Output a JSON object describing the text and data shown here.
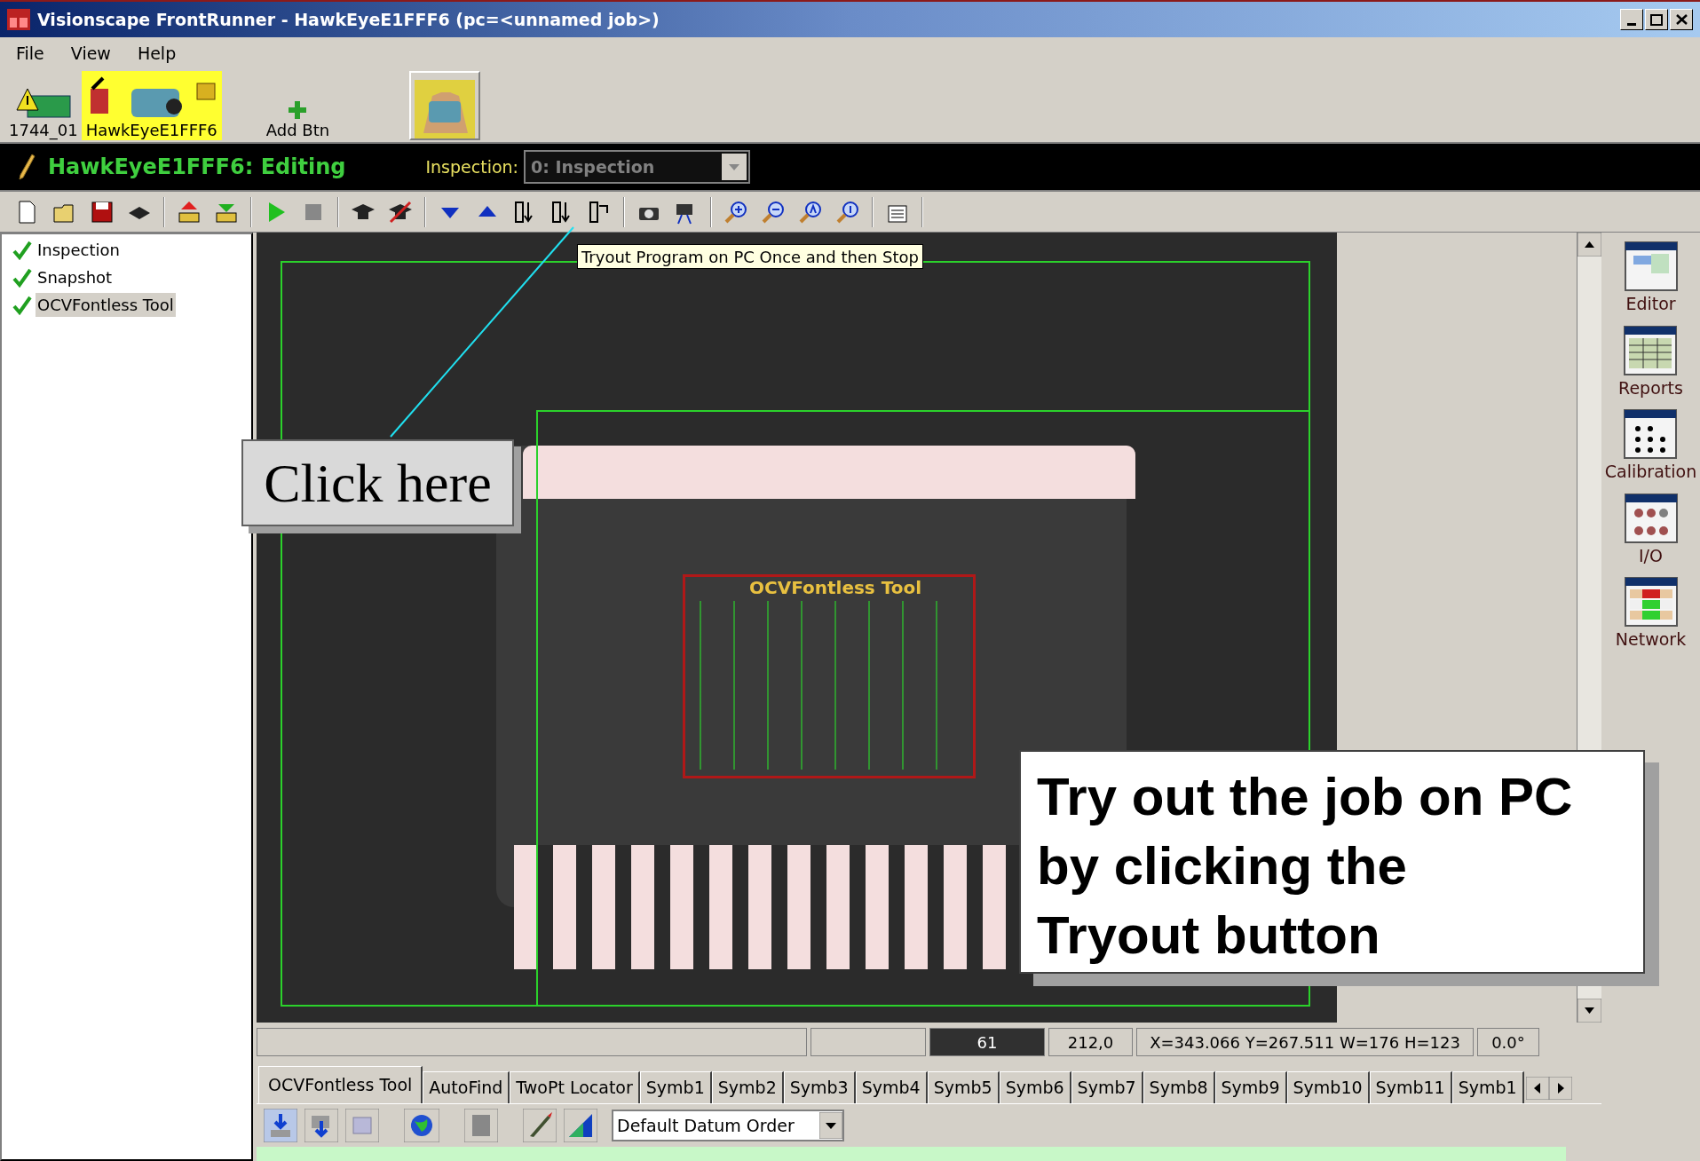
{
  "window": {
    "title": "Visionscape FrontRunner - HawkEyeE1FFF6 (pc=<unnamed job>)"
  },
  "menu": [
    "File",
    "View",
    "Help"
  ],
  "devices": [
    {
      "kind": "board",
      "label": "1744_01",
      "selected": false
    },
    {
      "kind": "camera",
      "label": "HawkEyeE1FFF6",
      "selected": true
    },
    {
      "kind": "add",
      "label": "Add Btn",
      "selected": false
    },
    {
      "kind": "hand",
      "selected": false
    }
  ],
  "editing_bar": {
    "title": "HawkEyeE1FFF6: Editing",
    "inspection_label": "Inspection:",
    "inspection_value": "0: Inspection",
    "disabled": true
  },
  "tooltip": "Tryout Program on PC Once and then Stop",
  "tree": [
    {
      "label": "Inspection",
      "checked": true,
      "selected": false
    },
    {
      "label": "Snapshot",
      "checked": true,
      "selected": false
    },
    {
      "label": "OCVFontless Tool",
      "checked": true,
      "selected": true
    }
  ],
  "image": {
    "tool_label": "OCVFontless Tool"
  },
  "status_bar": [
    "61",
    "212,0",
    "X=343.066 Y=267.511 W=176 H=123",
    "0.0°"
  ],
  "tabs": [
    {
      "label": "OCVFontless Tool",
      "selected": true
    },
    {
      "label": "AutoFind",
      "selected": false
    },
    {
      "label": "TwoPt Locator",
      "selected": false
    },
    {
      "label": "Symb1",
      "selected": false
    },
    {
      "label": "Symb2",
      "selected": false
    },
    {
      "label": "Symb3",
      "selected": false
    },
    {
      "label": "Symb4",
      "selected": false
    },
    {
      "label": "Symb5",
      "selected": false
    },
    {
      "label": "Symb6",
      "selected": false
    },
    {
      "label": "Symb7",
      "selected": false
    },
    {
      "label": "Symb8",
      "selected": false
    },
    {
      "label": "Symb9",
      "selected": false
    },
    {
      "label": "Symb10",
      "selected": false
    },
    {
      "label": "Symb11",
      "selected": false
    },
    {
      "label": "Symb1",
      "selected": false
    }
  ],
  "datum_order": "Default Datum Order",
  "sidebar": [
    "Editor",
    "Reports",
    "Calibration",
    "I/O",
    "Network"
  ],
  "annotations": {
    "click_here": "Click here",
    "callout": "Try out the job on PC by clicking the Tryout button"
  }
}
